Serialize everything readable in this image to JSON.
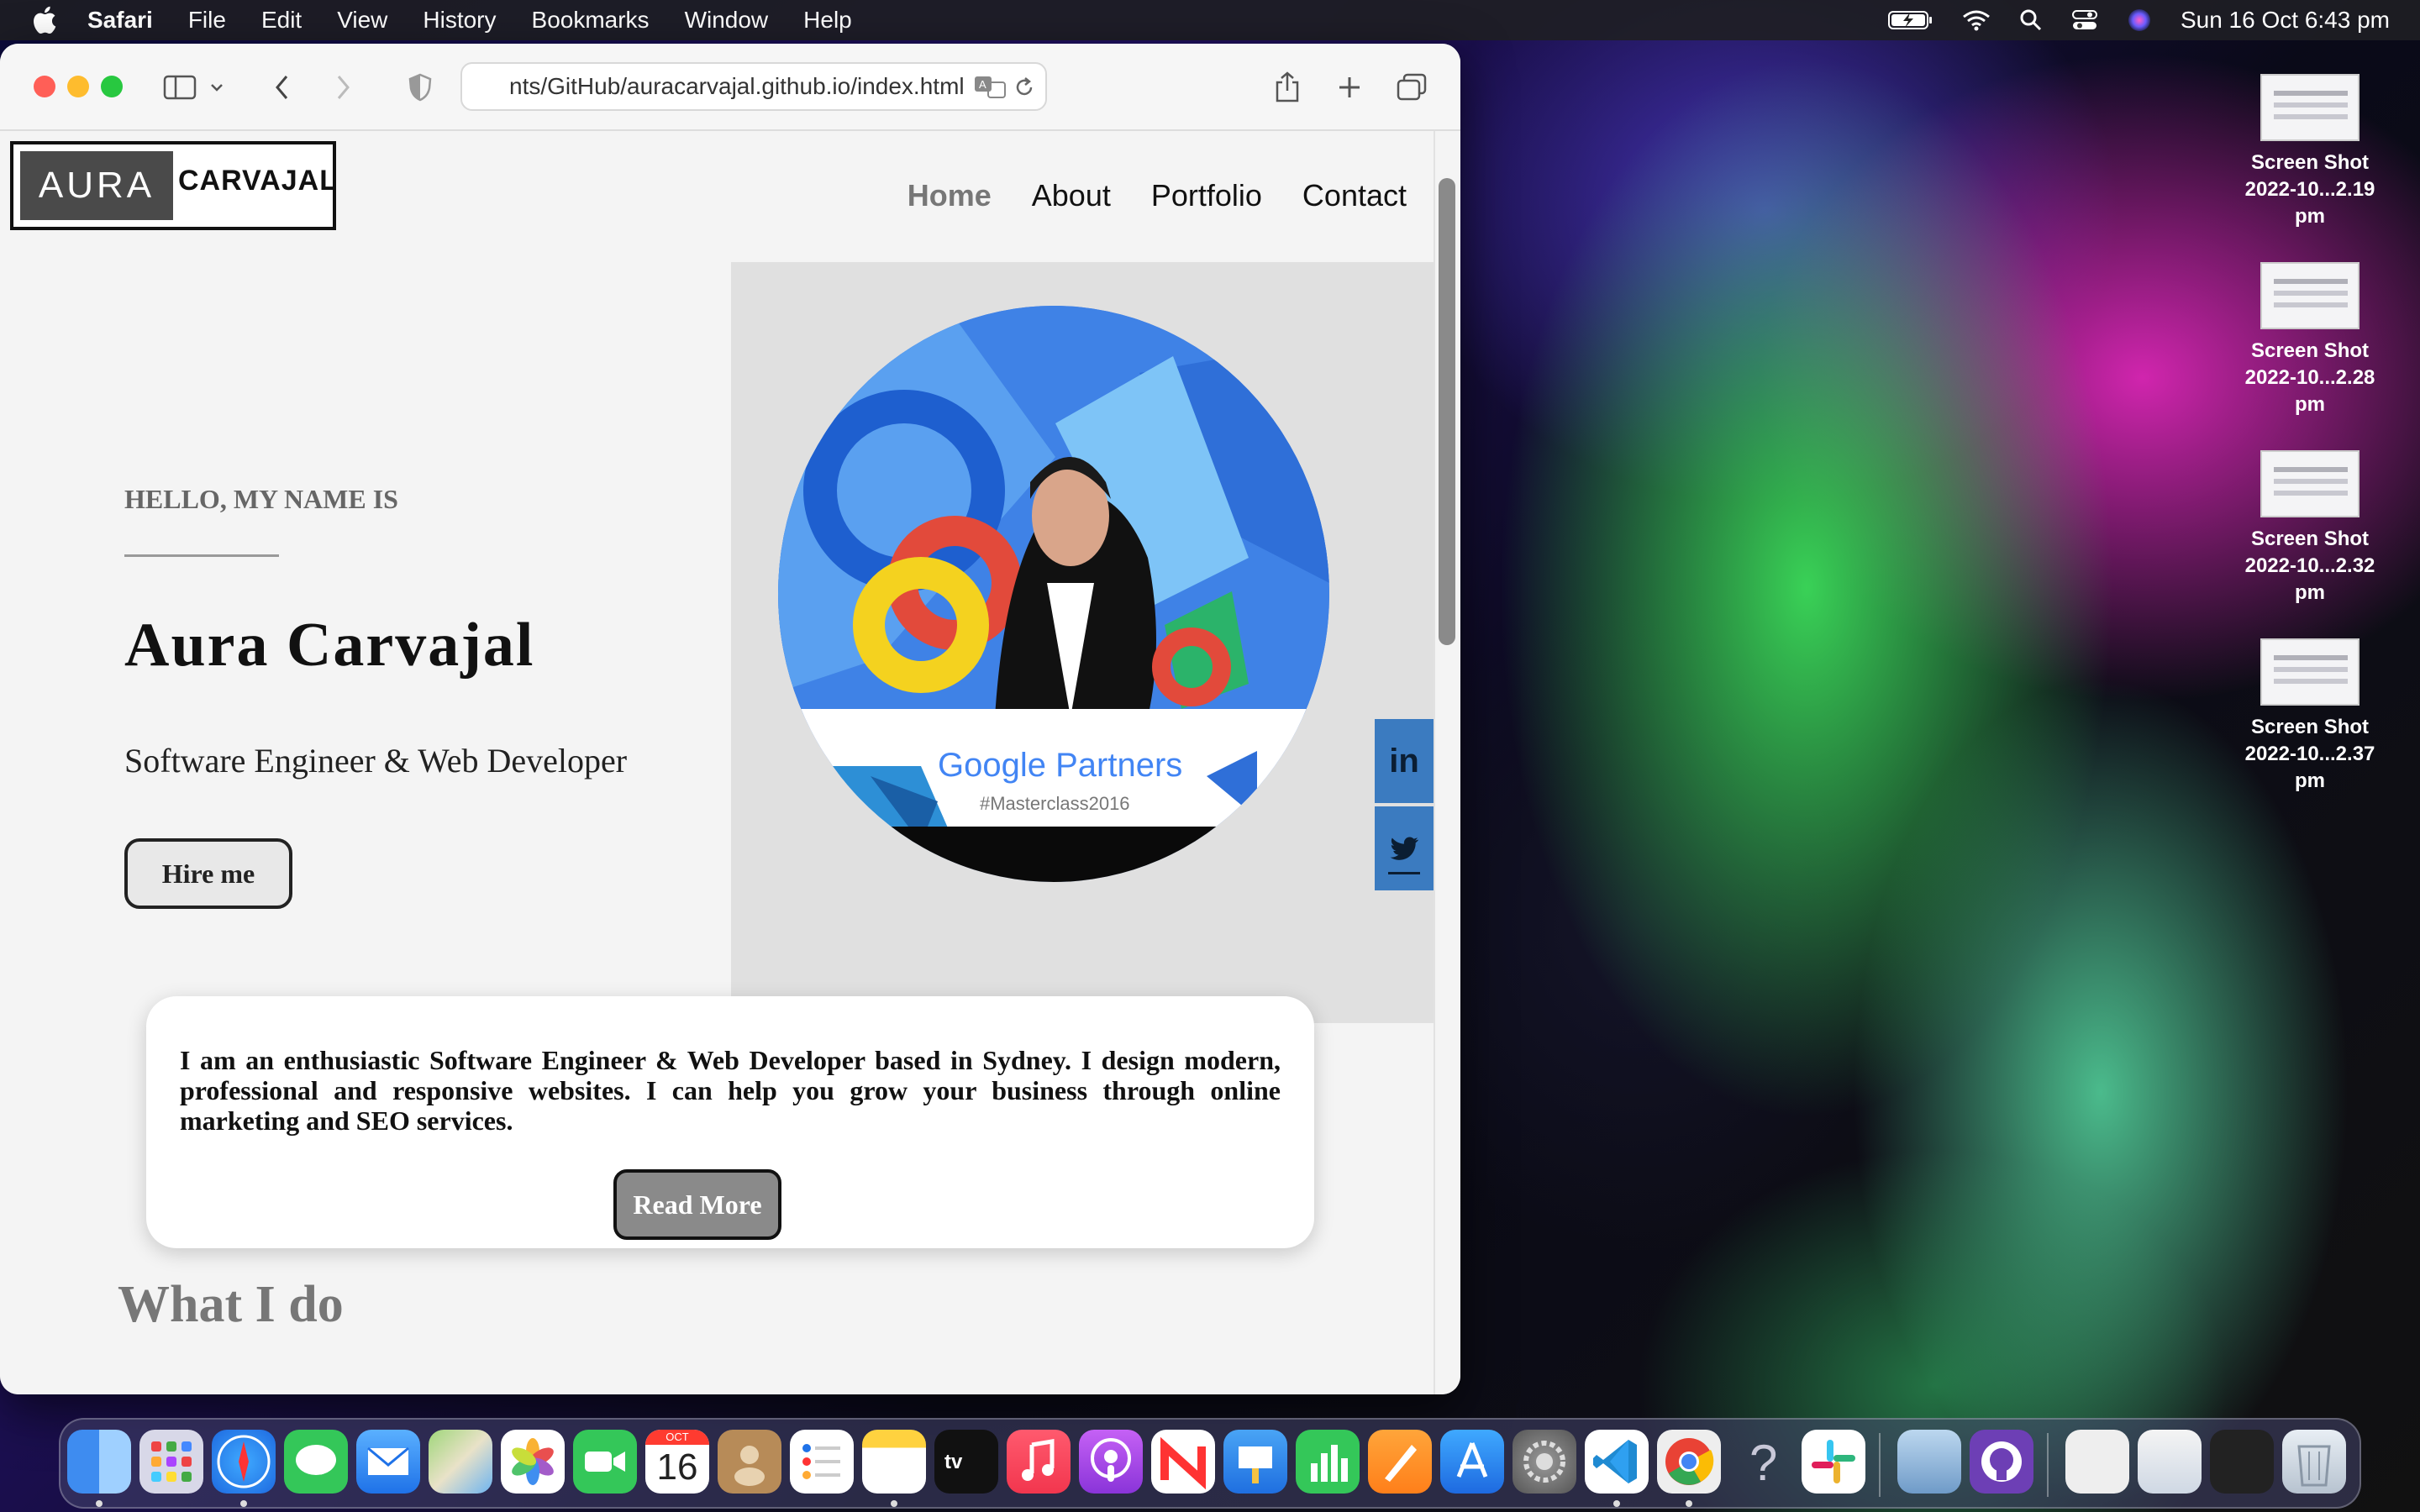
{
  "menubar": {
    "app_name": "Safari",
    "items": [
      "File",
      "Edit",
      "View",
      "History",
      "Bookmarks",
      "Window",
      "Help"
    ],
    "clock": "Sun 16 Oct  6:43 pm"
  },
  "desktop": {
    "icons": [
      {
        "line1": "Screen Shot",
        "line2": "2022-10...2.19 pm"
      },
      {
        "line1": "Screen Shot",
        "line2": "2022-10...2.28 pm"
      },
      {
        "line1": "Screen Shot",
        "line2": "2022-10...2.32 pm"
      },
      {
        "line1": "Screen Shot",
        "line2": "2022-10...2.37 pm"
      }
    ]
  },
  "browser": {
    "address": "nts/GitHub/auracarvajal.github.io/index.html"
  },
  "site": {
    "logo_left": "AURA",
    "logo_right": "CARVAJAL",
    "nav": [
      "Home",
      "About",
      "Portfolio",
      "Contact"
    ],
    "hello": "HELLO, MY NAME IS",
    "name": "Aura Carvajal",
    "role": "Software Engineer & Web Developer",
    "hire_label": "Hire me",
    "photo_banner": "Google Partners",
    "photo_tag": "#Masterclass2016",
    "about": "I am an enthusiastic Software Engineer & Web Developer based in Sydney. I design modern, professional and responsive websites. I can help you grow your business through online marketing and SEO services.",
    "readmore_label": "Read More",
    "section_title": "What I do",
    "social_linkedin": "in"
  },
  "dock": {
    "calendar_month": "OCT",
    "calendar_day": "16",
    "apps": [
      "finder",
      "launchpad",
      "safari",
      "messages",
      "mail",
      "maps",
      "photos",
      "facetime",
      "calendar",
      "contacts",
      "reminders",
      "notes",
      "tv",
      "music",
      "podcasts",
      "news",
      "keynote",
      "numbers",
      "pages",
      "app-store",
      "system-preferences",
      "vscode",
      "chrome",
      "help",
      "slack",
      "preview",
      "github-desktop"
    ]
  },
  "colors": {
    "social": "#3b7bc0",
    "photo_bg": "#3a78e0"
  }
}
